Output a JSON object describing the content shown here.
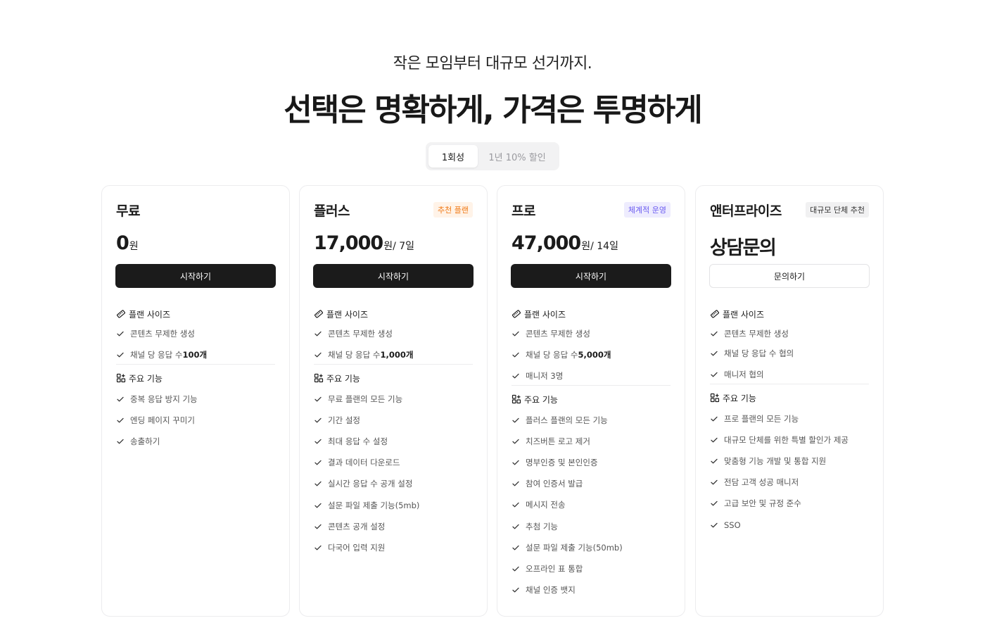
{
  "header": {
    "subtitle": "작은 모임부터 대규모 선거까지.",
    "title": "선택은 명확하게, 가격은 투명하게"
  },
  "billing_toggle": {
    "options": [
      "1회성",
      "1년 10% 할인"
    ],
    "selected": "1회성"
  },
  "colors": {
    "primary_dark": "#1b1b1b",
    "badge_orange": "#f07a16",
    "badge_purple": "#6b5cf0"
  },
  "plans": [
    {
      "name": "무료",
      "badge": "",
      "price_amount": "0",
      "price_unit": "원",
      "cta": "시작하기",
      "size_title": "플랜 사이즈",
      "size_items": [
        {
          "text": "콘텐츠 무제한 생성",
          "bold": ""
        },
        {
          "text": "채널 당 응답 수 ",
          "bold": "100개"
        }
      ],
      "features_title": "주요 기능",
      "features": [
        "중복 응답 방지 기능",
        "엔딩 페이지 꾸미기",
        "송출하기"
      ]
    },
    {
      "name": "플러스",
      "badge": "추천 플랜",
      "price_amount": "17,000",
      "price_unit": "원/ 7일",
      "cta": "시작하기",
      "size_title": "플랜 사이즈",
      "size_items": [
        {
          "text": "콘텐츠 무제한 생성",
          "bold": ""
        },
        {
          "text": "채널 당 응답 수 ",
          "bold": "1,000개"
        }
      ],
      "features_title": "주요 기능",
      "features": [
        "무료 플랜의 모든 기능",
        "기간 설정",
        "최대 응답 수 설정",
        "결과 데이터 다운로드",
        "실시간 응답 수 공개 설정",
        "설문 파일 제출 기능(5mb)",
        "콘텐츠 공개 설정",
        "다국어 입력 지원"
      ]
    },
    {
      "name": "프로",
      "badge": "체계적 운영",
      "price_amount": "47,000",
      "price_unit": "원/ 14일",
      "cta": "시작하기",
      "size_title": "플랜 사이즈",
      "size_items": [
        {
          "text": "콘텐츠 무제한 생성",
          "bold": ""
        },
        {
          "text": "채널 당 응답 수 ",
          "bold": "5,000개"
        },
        {
          "text": "매니저 3명",
          "bold": ""
        }
      ],
      "features_title": "주요 기능",
      "features": [
        "플러스 플랜의 모든 기능",
        "치즈버튼 로고 제거",
        "명부인증 및 본인인증",
        "참여 인증서 발급",
        "메시지 전송",
        "추첨 기능",
        "설문 파일 제출 기능(50mb)",
        "오프라인 표 통합",
        "채널 인증 뱃지"
      ]
    },
    {
      "name": "앤터프라이즈",
      "badge": "대규모 단체 추천",
      "price_amount": "상담문의",
      "price_unit": "",
      "cta": "문의하기",
      "size_title": "플랜 사이즈",
      "size_items": [
        {
          "text": "콘텐츠 무제한 생성",
          "bold": ""
        },
        {
          "text": "채널 당 응답 수 협의",
          "bold": ""
        },
        {
          "text": "매니저 협의",
          "bold": ""
        }
      ],
      "features_title": "주요 기능",
      "features": [
        "프로 플랜의 모든 기능",
        "대규모 단체를 위한 특별 할인가 제공",
        "맞춤형 기능 개발 및 통합 지원",
        "전담 고객 성공 매니저",
        "고급 보안 및 규정 준수",
        "SSO"
      ]
    }
  ]
}
